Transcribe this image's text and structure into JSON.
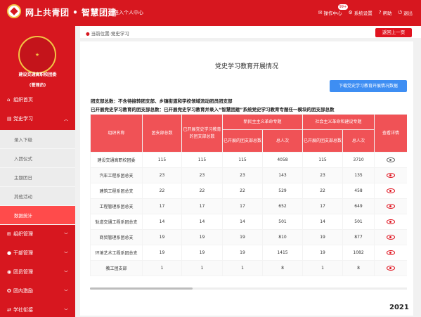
{
  "header": {
    "title": "网上共青团 • 智慧团建",
    "subtitle": "进入个人中心",
    "actions": [
      {
        "icon": "mail-icon",
        "label": "操作中心"
      },
      {
        "icon": "gear-icon",
        "label": "系统设置"
      },
      {
        "icon": "help-icon",
        "label": "帮助"
      },
      {
        "icon": "power-icon",
        "label": "退出"
      }
    ],
    "notification_badge": "99+"
  },
  "sidebar": {
    "org_name": "建设交通高职校团委",
    "role": "(管理员)",
    "menu": [
      {
        "icon": "home-icon",
        "label": "组织首页"
      },
      {
        "icon": "folder-icon",
        "label": "党史学习"
      },
      {
        "icon": "org-icon",
        "label": "组织管理"
      },
      {
        "icon": "user-icon",
        "label": "干部管理"
      },
      {
        "icon": "users-icon",
        "label": "团员管理"
      },
      {
        "icon": "award-icon",
        "label": "团内激励"
      },
      {
        "icon": "link-icon",
        "label": "学社衔接"
      }
    ],
    "submenu": [
      {
        "label": "录入下级"
      },
      {
        "label": "入团仪式"
      },
      {
        "label": "主题团日"
      },
      {
        "label": "其他活动"
      },
      {
        "label": "数据统计"
      }
    ]
  },
  "breadcrumb": {
    "text": "当前位置:党史学习",
    "back_button": "返回上一页"
  },
  "main": {
    "title": "党史学习教育开展情况",
    "download_button": "下载党史学习教育开展情况数据",
    "note1": "团支部总数：不含待接转团支部、乡镇街道和学校领域流动团员团支部",
    "note2": "已开展党史学习教育的团支部总数：已开展党史学习教育并录入“智慧团建”系统党史学习教育专题任一模块的团支部总数"
  },
  "table": {
    "headers": {
      "org_name": "组织名称",
      "branch_total": "团支部总数",
      "branch_done": "已开展党史学习教育的团支部总数",
      "group1": "新民主主义革命专题",
      "group2": "社会主义革命和建设专题",
      "g_branches": "已开展的团支部总数",
      "g_people": "总人次",
      "view": "查看详情"
    },
    "rows": [
      {
        "name": "建设交通高职校团委",
        "total": "115",
        "done": "115",
        "a1": "115",
        "a2": "4058",
        "b1": "115",
        "b2": "3710",
        "eye": "grey"
      },
      {
        "name": "汽车工程系团总支",
        "total": "23",
        "done": "23",
        "a1": "23",
        "a2": "143",
        "b1": "23",
        "b2": "135",
        "eye": "red"
      },
      {
        "name": "建筑工程系团总支",
        "total": "22",
        "done": "22",
        "a1": "22",
        "a2": "529",
        "b1": "22",
        "b2": "458",
        "eye": "red"
      },
      {
        "name": "工程管理系团总支",
        "total": "17",
        "done": "17",
        "a1": "17",
        "a2": "652",
        "b1": "17",
        "b2": "649",
        "eye": "red"
      },
      {
        "name": "轨道交通工程系团总支",
        "total": "14",
        "done": "14",
        "a1": "14",
        "a2": "501",
        "b1": "14",
        "b2": "501",
        "eye": "red"
      },
      {
        "name": "商贸管理系团总支",
        "total": "19",
        "done": "19",
        "a1": "19",
        "a2": "810",
        "b1": "19",
        "b2": "877",
        "eye": "red"
      },
      {
        "name": "环境艺术工程系团总支",
        "total": "19",
        "done": "19",
        "a1": "19",
        "a2": "1415",
        "b1": "19",
        "b2": "1082",
        "eye": "red"
      },
      {
        "name": "教工团支部",
        "total": "1",
        "done": "1",
        "a1": "1",
        "a2": "8",
        "b1": "1",
        "b2": "8",
        "eye": "red"
      }
    ]
  },
  "footer": {
    "year": "2021"
  },
  "colors": {
    "primary": "#d7171f",
    "header_cell": "#f05256",
    "download": "#3e8ef3",
    "active_sub": "#ff4b4b"
  }
}
